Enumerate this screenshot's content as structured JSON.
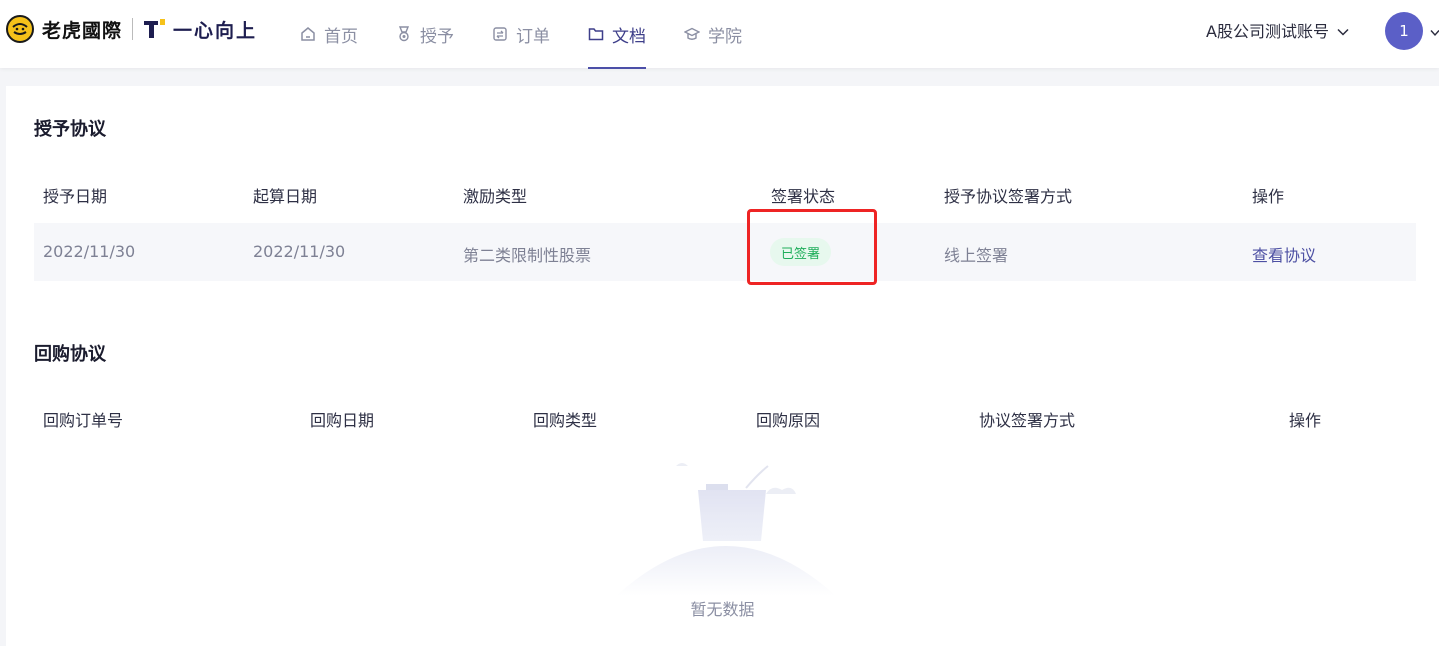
{
  "header": {
    "logo_text": "老虎國際",
    "brand_text": "一心向上",
    "nav": [
      {
        "label": "首页",
        "icon": "home-icon"
      },
      {
        "label": "授予",
        "icon": "medal-icon"
      },
      {
        "label": "订单",
        "icon": "order-icon"
      },
      {
        "label": "文档",
        "icon": "folder-icon",
        "active": true
      },
      {
        "label": "学院",
        "icon": "graduation-cap-icon"
      }
    ],
    "account_label": "A股公司测试账号",
    "avatar_text": "1"
  },
  "grant": {
    "title": "授予协议",
    "columns": [
      "授予日期",
      "起算日期",
      "激励类型",
      "签署状态",
      "授予协议签署方式",
      "操作"
    ],
    "row": {
      "grant_date": "2022/11/30",
      "start_date": "2022/11/30",
      "incentive_type": "第二类限制性股票",
      "status": "已签署",
      "sign_method": "线上签署",
      "action": "查看协议"
    }
  },
  "buyback": {
    "title": "回购协议",
    "columns": [
      "回购订单号",
      "回购日期",
      "回购类型",
      "回购原因",
      "协议签署方式",
      "操作"
    ],
    "empty_text": "暂无数据"
  },
  "colors": {
    "accent": "#4c4fa8",
    "status_green": "#1fae5b",
    "highlight_red": "#ee2424",
    "avatar": "#5b5fc7"
  }
}
